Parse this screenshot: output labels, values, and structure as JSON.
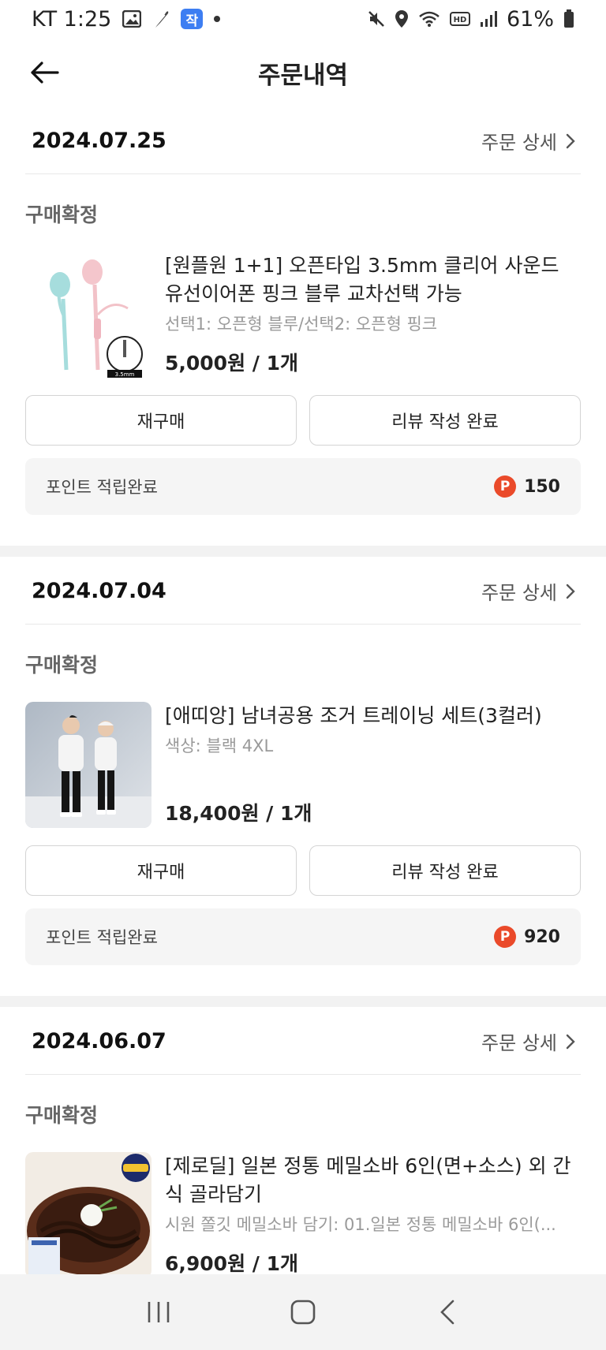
{
  "status_bar": {
    "carrier_time": "KT 1:25",
    "app_badge": "작",
    "battery": "61%",
    "icons": [
      "gallery-icon",
      "feather-icon",
      "app-badge-icon",
      "dot-icon",
      "mute-icon",
      "location-icon",
      "wifi-icon",
      "hd-icon",
      "signal-icon",
      "battery-icon"
    ]
  },
  "header": {
    "title": "주문내역",
    "back_icon": "arrow-left-icon"
  },
  "orders": [
    {
      "date": "2024.07.25",
      "detail_label": "주문 상세",
      "status": "구매확정",
      "product_name": "[원플원 1+1] 오픈타입 3.5mm 클리어 사운드 유선이어폰 핑크 블루 교차선택 가능",
      "option": "선택1: 오픈형 블루/선택2: 오픈형 핑크",
      "price": "5,000원 / 1개",
      "thumb_label": "3.5mm",
      "rebuy_label": "재구매",
      "review_label": "리뷰 작성 완료",
      "points_label": "포인트 적립완료",
      "points_badge": "P",
      "points_value": "150"
    },
    {
      "date": "2024.07.04",
      "detail_label": "주문 상세",
      "status": "구매확정",
      "product_name": "[애띠앙] 남녀공용 조거 트레이닝 세트(3컬러)",
      "option": "색상: 블랙 4XL",
      "price": "18,400원 / 1개",
      "rebuy_label": "재구매",
      "review_label": "리뷰 작성 완료",
      "points_label": "포인트 적립완료",
      "points_badge": "P",
      "points_value": "920"
    },
    {
      "date": "2024.06.07",
      "detail_label": "주문 상세",
      "status": "구매확정",
      "product_name": "[제로딜] 일본 정통 메밀소바 6인(면+소스) 외 간식 골라담기",
      "option": "시원 쫄깃 메밀소바 담기: 01.일본 정통 메밀소바 6인(...",
      "price": "6,900원 / 1개"
    }
  ],
  "nav": {
    "icons": [
      "recent-apps-icon",
      "home-icon",
      "back-icon"
    ]
  }
}
